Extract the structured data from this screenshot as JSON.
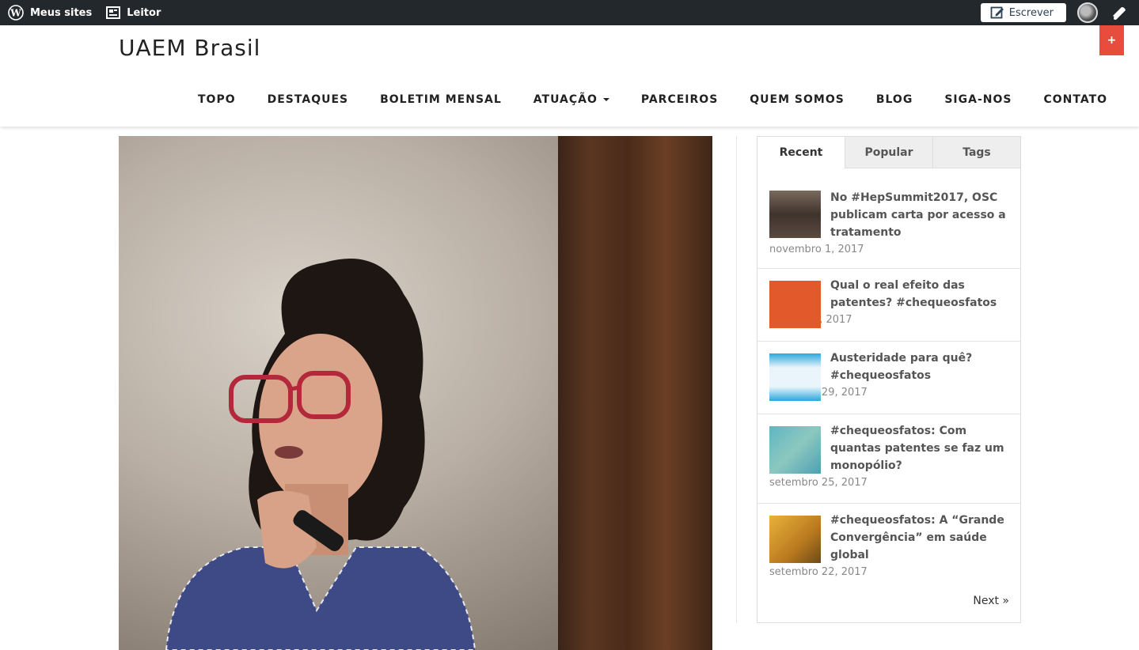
{
  "admin_bar": {
    "my_sites": "Meus sites",
    "reader": "Leitor",
    "write": "Escrever",
    "icons": [
      "wordpress-icon",
      "reader-icon",
      "write-icon",
      "avatar",
      "notifications-icon"
    ]
  },
  "site": {
    "title": "UAEM Brasil",
    "plus": "+"
  },
  "nav": {
    "items": [
      "TOPO",
      "DESTAQUES",
      "BOLETIM MENSAL",
      "ATUAÇÃO",
      "PARCEIROS",
      "QUEM SOMOS",
      "BLOG",
      "SIGA-NOS",
      "CONTATO"
    ]
  },
  "sidebar": {
    "tabs": [
      "Recent",
      "Popular",
      "Tags"
    ],
    "active_tab": "Recent",
    "posts": [
      {
        "title": "No #HepSummit2017, OSC publicam carta por acesso a tratamento",
        "date": "novembro 1, 2017",
        "thumb_color": "#5a4a40"
      },
      {
        "title": "Qual o real efeito das patentes? #chequeosfatos",
        "date": "outubro 3, 2017",
        "thumb_color": "#e25a2c"
      },
      {
        "title": "Austeridade para quê? #chequeosfatos",
        "date": "setembro 29, 2017",
        "thumb_color": "#3bb3e0"
      },
      {
        "title": "#chequeosfatos: Com quantas patentes se faz um monopólio?",
        "date": "setembro 25, 2017",
        "thumb_color": "#5fb6c2"
      },
      {
        "title": "#chequeosfatos: A “Grande Convergência” em saúde global",
        "date": "setembro 22, 2017",
        "thumb_color": "#d99a2b"
      }
    ],
    "next": "Next »"
  }
}
